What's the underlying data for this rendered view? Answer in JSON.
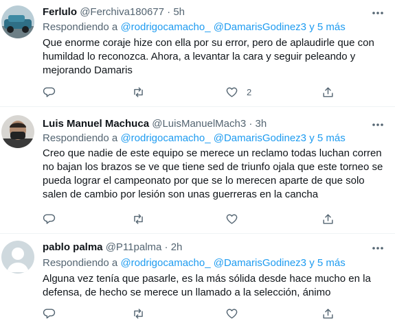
{
  "tweets": [
    {
      "display_name": "Ferlulo",
      "handle": "@Ferchiva180677",
      "separator": "·",
      "time": "5h",
      "replying_prefix": "Respondiendo a ",
      "mention_1": "@rodrigocamacho_",
      "mention_2": "@DamarisGodinez3",
      "mention_more": "y 5 más",
      "text": "Que enorme coraje hize con ella por su error, pero de aplaudirle que con humildad lo reconozca. Ahora, a levantar la cara y seguir peleando y mejorando Damaris",
      "like_count": "2",
      "avatar_icon": "car-photo-avatar"
    },
    {
      "display_name": "Luis Manuel Machuca",
      "handle": "@LuisManuelMach3",
      "separator": "·",
      "time": "3h",
      "replying_prefix": "Respondiendo a ",
      "mention_1": "@rodrigocamacho_",
      "mention_2": "@DamarisGodinez3",
      "mention_more": "y 5 más",
      "text": "Creo que  nadie de este equipo se merece un reclamo todas luchan corren no bajan los brazos se ve que tiene sed de triunfo ojala que este torneo se pueda lograr el campeonato por que se lo merecen aparte de que solo salen de cambio por lesión son unas guerreras en la cancha",
      "like_count": "",
      "avatar_icon": "man-with-mask-avatar"
    },
    {
      "display_name": "pablo palma",
      "handle": "@P11palma",
      "separator": "·",
      "time": "2h",
      "replying_prefix": "Respondiendo a ",
      "mention_1": "@rodrigocamacho_",
      "mention_2": "@DamarisGodinez3",
      "mention_more": "y 5 más",
      "text": "Alguna vez tenía que pasarle, es la más sólida desde hace mucho en la defensa, de hecho se merece un llamado a la selección, ánimo",
      "like_count": "",
      "avatar_icon": "default-user-avatar"
    }
  ],
  "colors": {
    "link": "#1d9bf0",
    "secondary_text": "#536471",
    "primary_text": "#0f1419",
    "divider": "#eff3f4"
  }
}
